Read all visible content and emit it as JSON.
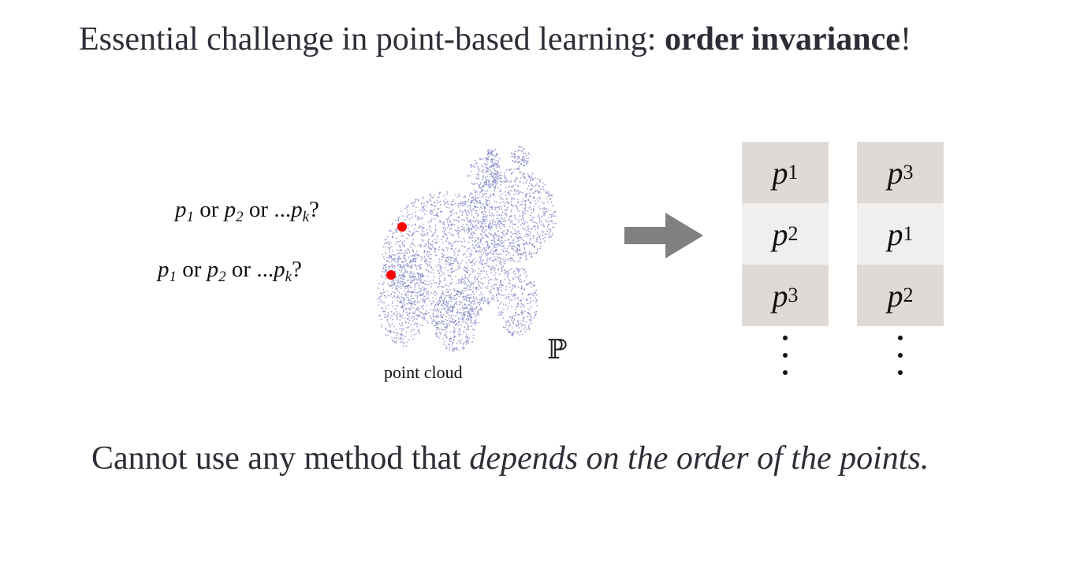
{
  "title": {
    "prefix": "Essential challenge in point-based learning: ",
    "emphasis": "order invariance",
    "suffix": "!"
  },
  "left_panel": {
    "queries": [
      {
        "p": "p",
        "s1": "1",
        "or1": " or ",
        "s2": "2",
        "or2": " or ",
        "dots": "...",
        "sk": "k",
        "q": "?"
      },
      {
        "p": "p",
        "s1": "1",
        "or1": " or ",
        "s2": "2",
        "or2": " or ",
        "dots": "...",
        "sk": "k",
        "q": "?"
      }
    ],
    "cloud_label": "point cloud",
    "set_symbol": "ℙ",
    "colors": {
      "points": "#7f7fc4",
      "highlight": "#ff0000"
    }
  },
  "arrow": {
    "icon": "right-arrow-icon",
    "color": "#808080"
  },
  "orderings": {
    "column_a": [
      {
        "p": "p",
        "sub": "1"
      },
      {
        "p": "p",
        "sub": "2"
      },
      {
        "p": "p",
        "sub": "3"
      }
    ],
    "column_b": [
      {
        "p": "p",
        "sub": "3"
      },
      {
        "p": "p",
        "sub": "1"
      },
      {
        "p": "p",
        "sub": "2"
      }
    ],
    "colors": {
      "dark_cell": "#e0dad6",
      "light_cell": "#f1efee"
    }
  },
  "footer": {
    "prefix": "Cannot use any method that ",
    "emphasis": "depends on the order of the points."
  }
}
